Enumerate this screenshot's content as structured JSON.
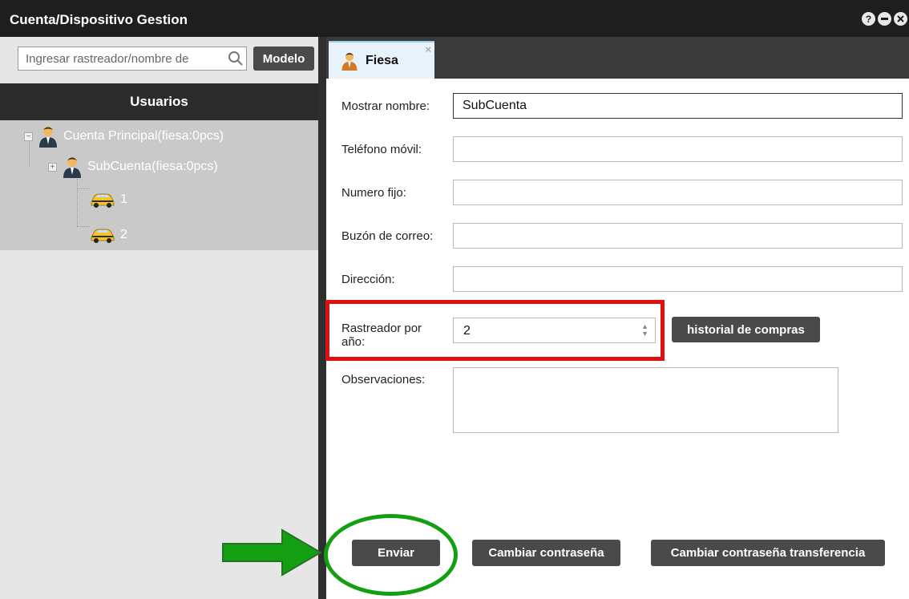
{
  "window": {
    "title": "Cuenta/Dispositivo Gestion",
    "controls": [
      "help-icon",
      "minimize-icon",
      "close-icon"
    ]
  },
  "left_panel": {
    "search": {
      "placeholder": "Ingresar rastreador/nombre de",
      "icon": "search-icon"
    },
    "model_button": "Modelo",
    "users_header": "Usuarios",
    "tree": [
      {
        "label": "Cuenta Principal(fiesa:0pcs)",
        "icon": "user-icon",
        "toggle": "−"
      },
      {
        "label": "SubCuenta(fiesa:0pcs)",
        "icon": "user-icon",
        "toggle": "+"
      },
      {
        "label": "1",
        "icon": "car-icon"
      },
      {
        "label": "2",
        "icon": "car-icon"
      }
    ]
  },
  "right_panel": {
    "tab": {
      "label": "Fiesa",
      "icon": "user-icon",
      "close": "×"
    },
    "form": {
      "display_name": {
        "label": "Mostrar nombre:",
        "value": "SubCuenta"
      },
      "mobile_phone": {
        "label": "Teléfono móvil:",
        "value": ""
      },
      "landline": {
        "label": "Numero fijo:",
        "value": ""
      },
      "email": {
        "label": "Buzón de correo:",
        "value": ""
      },
      "address": {
        "label": "Dirección:",
        "value": ""
      },
      "trackers_per_year": {
        "label_line1": "Rastreador por",
        "label_line2": "año:",
        "value": "2"
      },
      "purchase_history_button": "historial de compras",
      "observations": {
        "label": "Observaciones:",
        "value": ""
      }
    },
    "buttons": {
      "send": "Enviar",
      "change_password": "Cambiar contraseña",
      "change_transfer_password": "Cambiar contraseña transferencia"
    }
  },
  "annotations": {
    "highlight_color": "#e01010",
    "circle_color": "#12a012",
    "arrow_color": "#12a012"
  },
  "colors": {
    "titlebar": "#1e1e1e",
    "button_dark": "#4a4a4a",
    "tree_bg": "#c9c9c9",
    "left_bg": "#e6e6e6"
  }
}
